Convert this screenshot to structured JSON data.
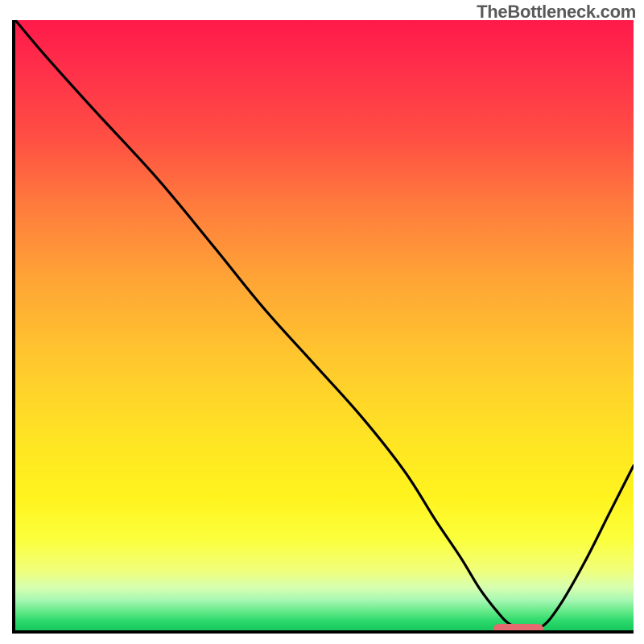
{
  "watermark": "TheBottleneck.com",
  "chart_data": {
    "type": "line",
    "title": "",
    "xlabel": "",
    "ylabel": "",
    "xlim": [
      0,
      100
    ],
    "ylim": [
      0,
      100
    ],
    "x": [
      0,
      5,
      13,
      23,
      32,
      40,
      48,
      56,
      63,
      68,
      72,
      75,
      78,
      80,
      82,
      85,
      88,
      92,
      96,
      100
    ],
    "values": [
      100,
      94,
      85,
      74,
      63,
      53,
      44,
      35,
      26,
      18,
      12,
      7,
      3,
      1,
      0.5,
      0.5,
      4,
      11,
      19,
      27
    ],
    "marker": {
      "x_start": 77,
      "x_end": 85,
      "y": 0.7
    },
    "gradient_stops": [
      {
        "pct": 0,
        "color": "#ff1a4a"
      },
      {
        "pct": 30,
        "color": "#ff7a3d"
      },
      {
        "pct": 55,
        "color": "#ffc62e"
      },
      {
        "pct": 78,
        "color": "#fff31e"
      },
      {
        "pct": 90,
        "color": "#f1ff78"
      },
      {
        "pct": 97,
        "color": "#61e986"
      },
      {
        "pct": 100,
        "color": "#18c85e"
      }
    ]
  }
}
